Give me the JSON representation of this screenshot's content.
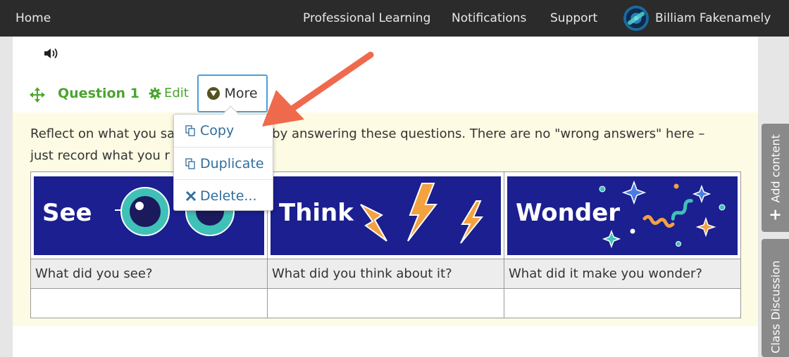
{
  "topbar": {
    "home": "Home",
    "nav": [
      "Professional Learning",
      "Notifications",
      "Support"
    ],
    "user_name": "Billiam Fakenamely"
  },
  "question": {
    "title": "Question 1",
    "edit_label": "Edit",
    "more_label": "More",
    "prompt": "Reflect on what you saw, thought and wondered by answering these questions. There are no \"wrong answers\" here – just record what you really saw and thought.",
    "prompt_visible_line1": "Reflect on what you sa",
    "prompt_visible_line1b": "by answering these questions. There are no \"wrong answers\" here –",
    "prompt_visible_line2": "just record what you r",
    "prompt_visible_line2b": "."
  },
  "dropdown": {
    "items": [
      {
        "label": "Copy",
        "icon": "copy-icon"
      },
      {
        "label": "Duplicate",
        "icon": "duplicate-icon"
      },
      {
        "label": "Delete...",
        "icon": "close-icon"
      }
    ]
  },
  "table": {
    "panels": [
      "See",
      "Think",
      "Wonder"
    ],
    "questions": [
      "What did you see?",
      "What did you think about it?",
      "What did it make you wonder?"
    ],
    "answers": [
      "",
      "",
      ""
    ]
  },
  "sidebar": {
    "add_content": "Add content",
    "class_discussion": "Class Discussion"
  },
  "colors": {
    "topbar_bg": "#2b2b2b",
    "accent_green": "#4aa52e",
    "link_blue": "#2f6e9e",
    "panel_navy": "#1b1f8f",
    "question_bg": "#fdfbe3",
    "annotation_arrow": "#ef6a4c"
  }
}
